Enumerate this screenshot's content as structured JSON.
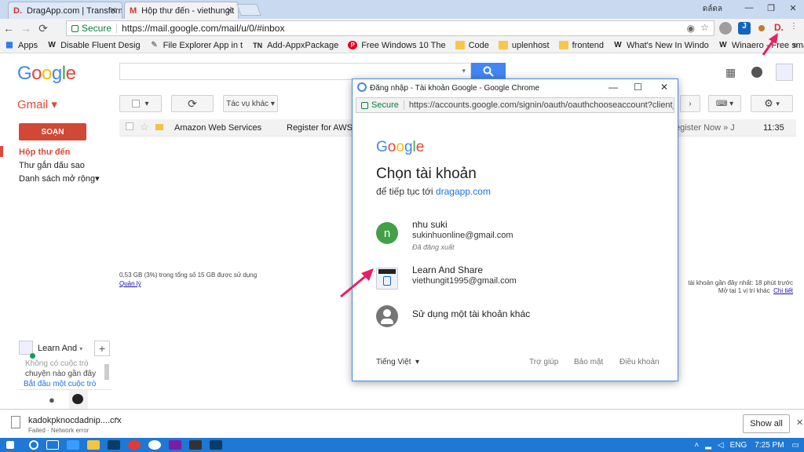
{
  "tabs": [
    {
      "label": "DragApp.com | Transform",
      "favicon": "D."
    },
    {
      "label": "Hộp thư đến - viethungit",
      "favicon": "M"
    }
  ],
  "window_label": "ดล์ดล",
  "address_bar": {
    "secure_label": "Secure",
    "url": "https://mail.google.com/mail/u/0/#inbox"
  },
  "bookmarks": [
    {
      "label": "Apps",
      "icon": "apps-icon"
    },
    {
      "label": "Disable Fluent Desig",
      "icon": "W"
    },
    {
      "label": "File Explorer App in t",
      "icon": "pen-icon"
    },
    {
      "label": "Add-AppxPackage",
      "icon": "TN"
    },
    {
      "label": "Free Windows 10 The",
      "icon": "pinterest-icon"
    },
    {
      "label": "Code",
      "icon": "folder-icon"
    },
    {
      "label": "uplenhost",
      "icon": "folder-icon"
    },
    {
      "label": "frontend",
      "icon": "folder-icon"
    },
    {
      "label": "What's New In Windo",
      "icon": "W"
    },
    {
      "label": "Winaero - Free small",
      "icon": "W"
    }
  ],
  "gmail": {
    "logo": "Google",
    "label": "Gmail",
    "compose": "SOẠN",
    "nav": [
      "Hộp thư đến",
      "Thư gắn dấu sao",
      "Danh sách mở rộng"
    ],
    "more_actions": "Tác vụ khác",
    "mail_row": {
      "sender": "Amazon Web Services",
      "subject": "Register for AWS W",
      "snippet": "egister Now » J",
      "time": "11:35"
    },
    "storage": "0,53 GB (3%) trong tổng số 15 GB được sử dụng",
    "manage": "Quản lý",
    "activity_line1": "tài khoản gần đây nhất: 18 phút trước",
    "activity_line2": "Mở tại 1 vị trí khác",
    "details": "Chi tiết",
    "hangout_name": "Learn And",
    "hangout_line1": "Không có cuộc trò",
    "hangout_line2": "chuyện nào gần đây",
    "hangout_link": "Bắt đầu một cuộc trò"
  },
  "popup": {
    "title": "Đăng nhập - Tài khoản Google - Google Chrome",
    "secure_label": "Secure",
    "url": "https://accounts.google.com/signin/oauth/oauthchooseaccount?client_i...",
    "logo": "Google",
    "heading": "Chọn tài khoản",
    "subtitle_prefix": "để tiếp tục tới",
    "subtitle_link": "dragapp.com",
    "accounts": [
      {
        "initial": "n",
        "name": "nhu suki",
        "email": "sukinhuonline@gmail.com",
        "status": "Đã đăng xuất",
        "color": "#43a047"
      },
      {
        "name": "Learn And Share",
        "email": "viethungit1995@gmail.com",
        "status": ""
      }
    ],
    "other_account": "Sử dụng một tài khoản khác",
    "language": "Tiếng Việt",
    "footer": [
      "Trợ giúp",
      "Bảo mật",
      "Điều khoản"
    ]
  },
  "download": {
    "file": "kadokpknocdadnip....crx",
    "status": "Failed - Network error",
    "show_all": "Show all"
  },
  "taskbar": {
    "lang": "ENG",
    "time": "7:25 PM"
  }
}
